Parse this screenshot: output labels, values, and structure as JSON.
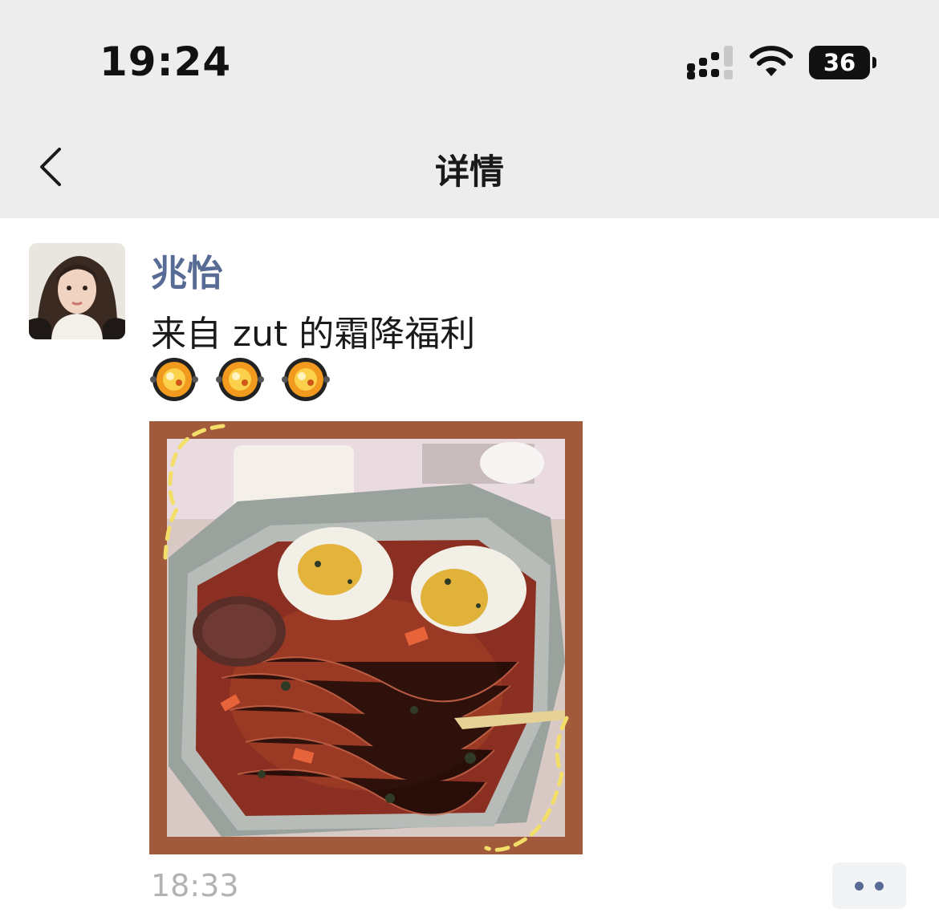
{
  "status_bar": {
    "time": "19:24",
    "battery": "36",
    "icons": [
      "cellular-signal-icon",
      "wifi-icon",
      "battery-icon"
    ]
  },
  "nav": {
    "title": "详情",
    "back_icon": "chevron-left-icon"
  },
  "post": {
    "username": "兆怡",
    "text": "来自 zut 的霜降福利",
    "emojis": [
      "shallow-pan-of-food-emoji",
      "shallow-pan-of-food-emoji",
      "shallow-pan-of-food-emoji"
    ],
    "image": "photo of spicy hotpot with noodles, eggs and sausage in aluminum tray",
    "time": "18:33",
    "more_icon": "two-dots-icon"
  },
  "colors": {
    "header_bg": "#ededed",
    "username": "#576b95",
    "timestamp": "#b2b2b2",
    "photo_frame": "#a25a3c"
  }
}
